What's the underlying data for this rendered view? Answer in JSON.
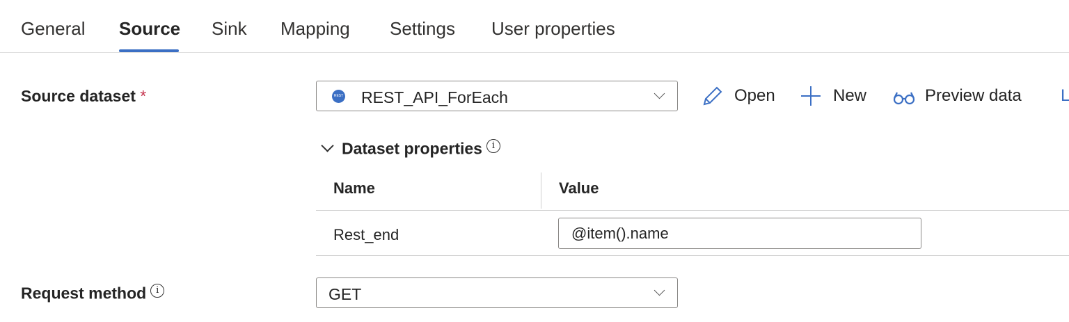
{
  "tabs": [
    {
      "label": "General"
    },
    {
      "label": "Source",
      "active": true
    },
    {
      "label": "Sink"
    },
    {
      "label": "Mapping"
    },
    {
      "label": "Settings"
    },
    {
      "label": "User properties"
    }
  ],
  "source_dataset": {
    "label": "Source dataset",
    "required_mark": "*",
    "selected": "REST_API_ForEach",
    "dataset_icon": "rest-icon",
    "dataset_icon_text": "REST",
    "actions": {
      "open": "Open",
      "new": "New",
      "preview": "Preview data",
      "learn_more_partial": "L"
    }
  },
  "dataset_properties": {
    "title": "Dataset properties",
    "columns": {
      "name": "Name",
      "value": "Value"
    },
    "rows": [
      {
        "name": "Rest_end",
        "value": "@item().name"
      }
    ]
  },
  "request_method": {
    "label": "Request method",
    "selected": "GET"
  },
  "colors": {
    "accent": "#3b6fc4",
    "required": "#c4314b"
  }
}
